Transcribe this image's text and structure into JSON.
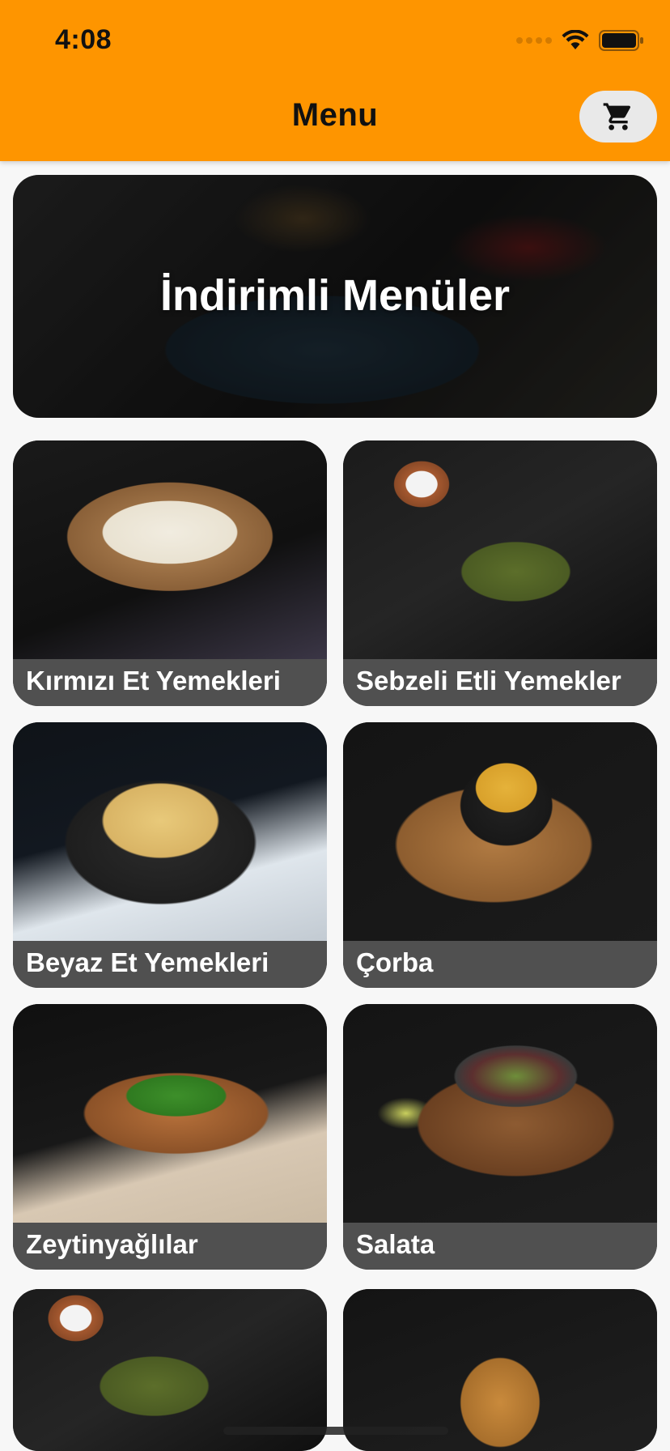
{
  "status_bar": {
    "time": "4:08"
  },
  "header": {
    "title": "Menu",
    "cart_icon": "shopping-cart-icon"
  },
  "banner": {
    "title": "İndirimli Menüler"
  },
  "categories": [
    {
      "label": "Kırmızı Et Yemekleri"
    },
    {
      "label": "Sebzeli Etli Yemekler"
    },
    {
      "label": "Beyaz Et Yemekleri"
    },
    {
      "label": "Çorba"
    },
    {
      "label": "Zeytinyağlılar"
    },
    {
      "label": "Salata"
    },
    {
      "label": ""
    },
    {
      "label": ""
    }
  ],
  "colors": {
    "header": "#fe9500",
    "label_bar": "#505050",
    "background": "#f7f7f7"
  }
}
